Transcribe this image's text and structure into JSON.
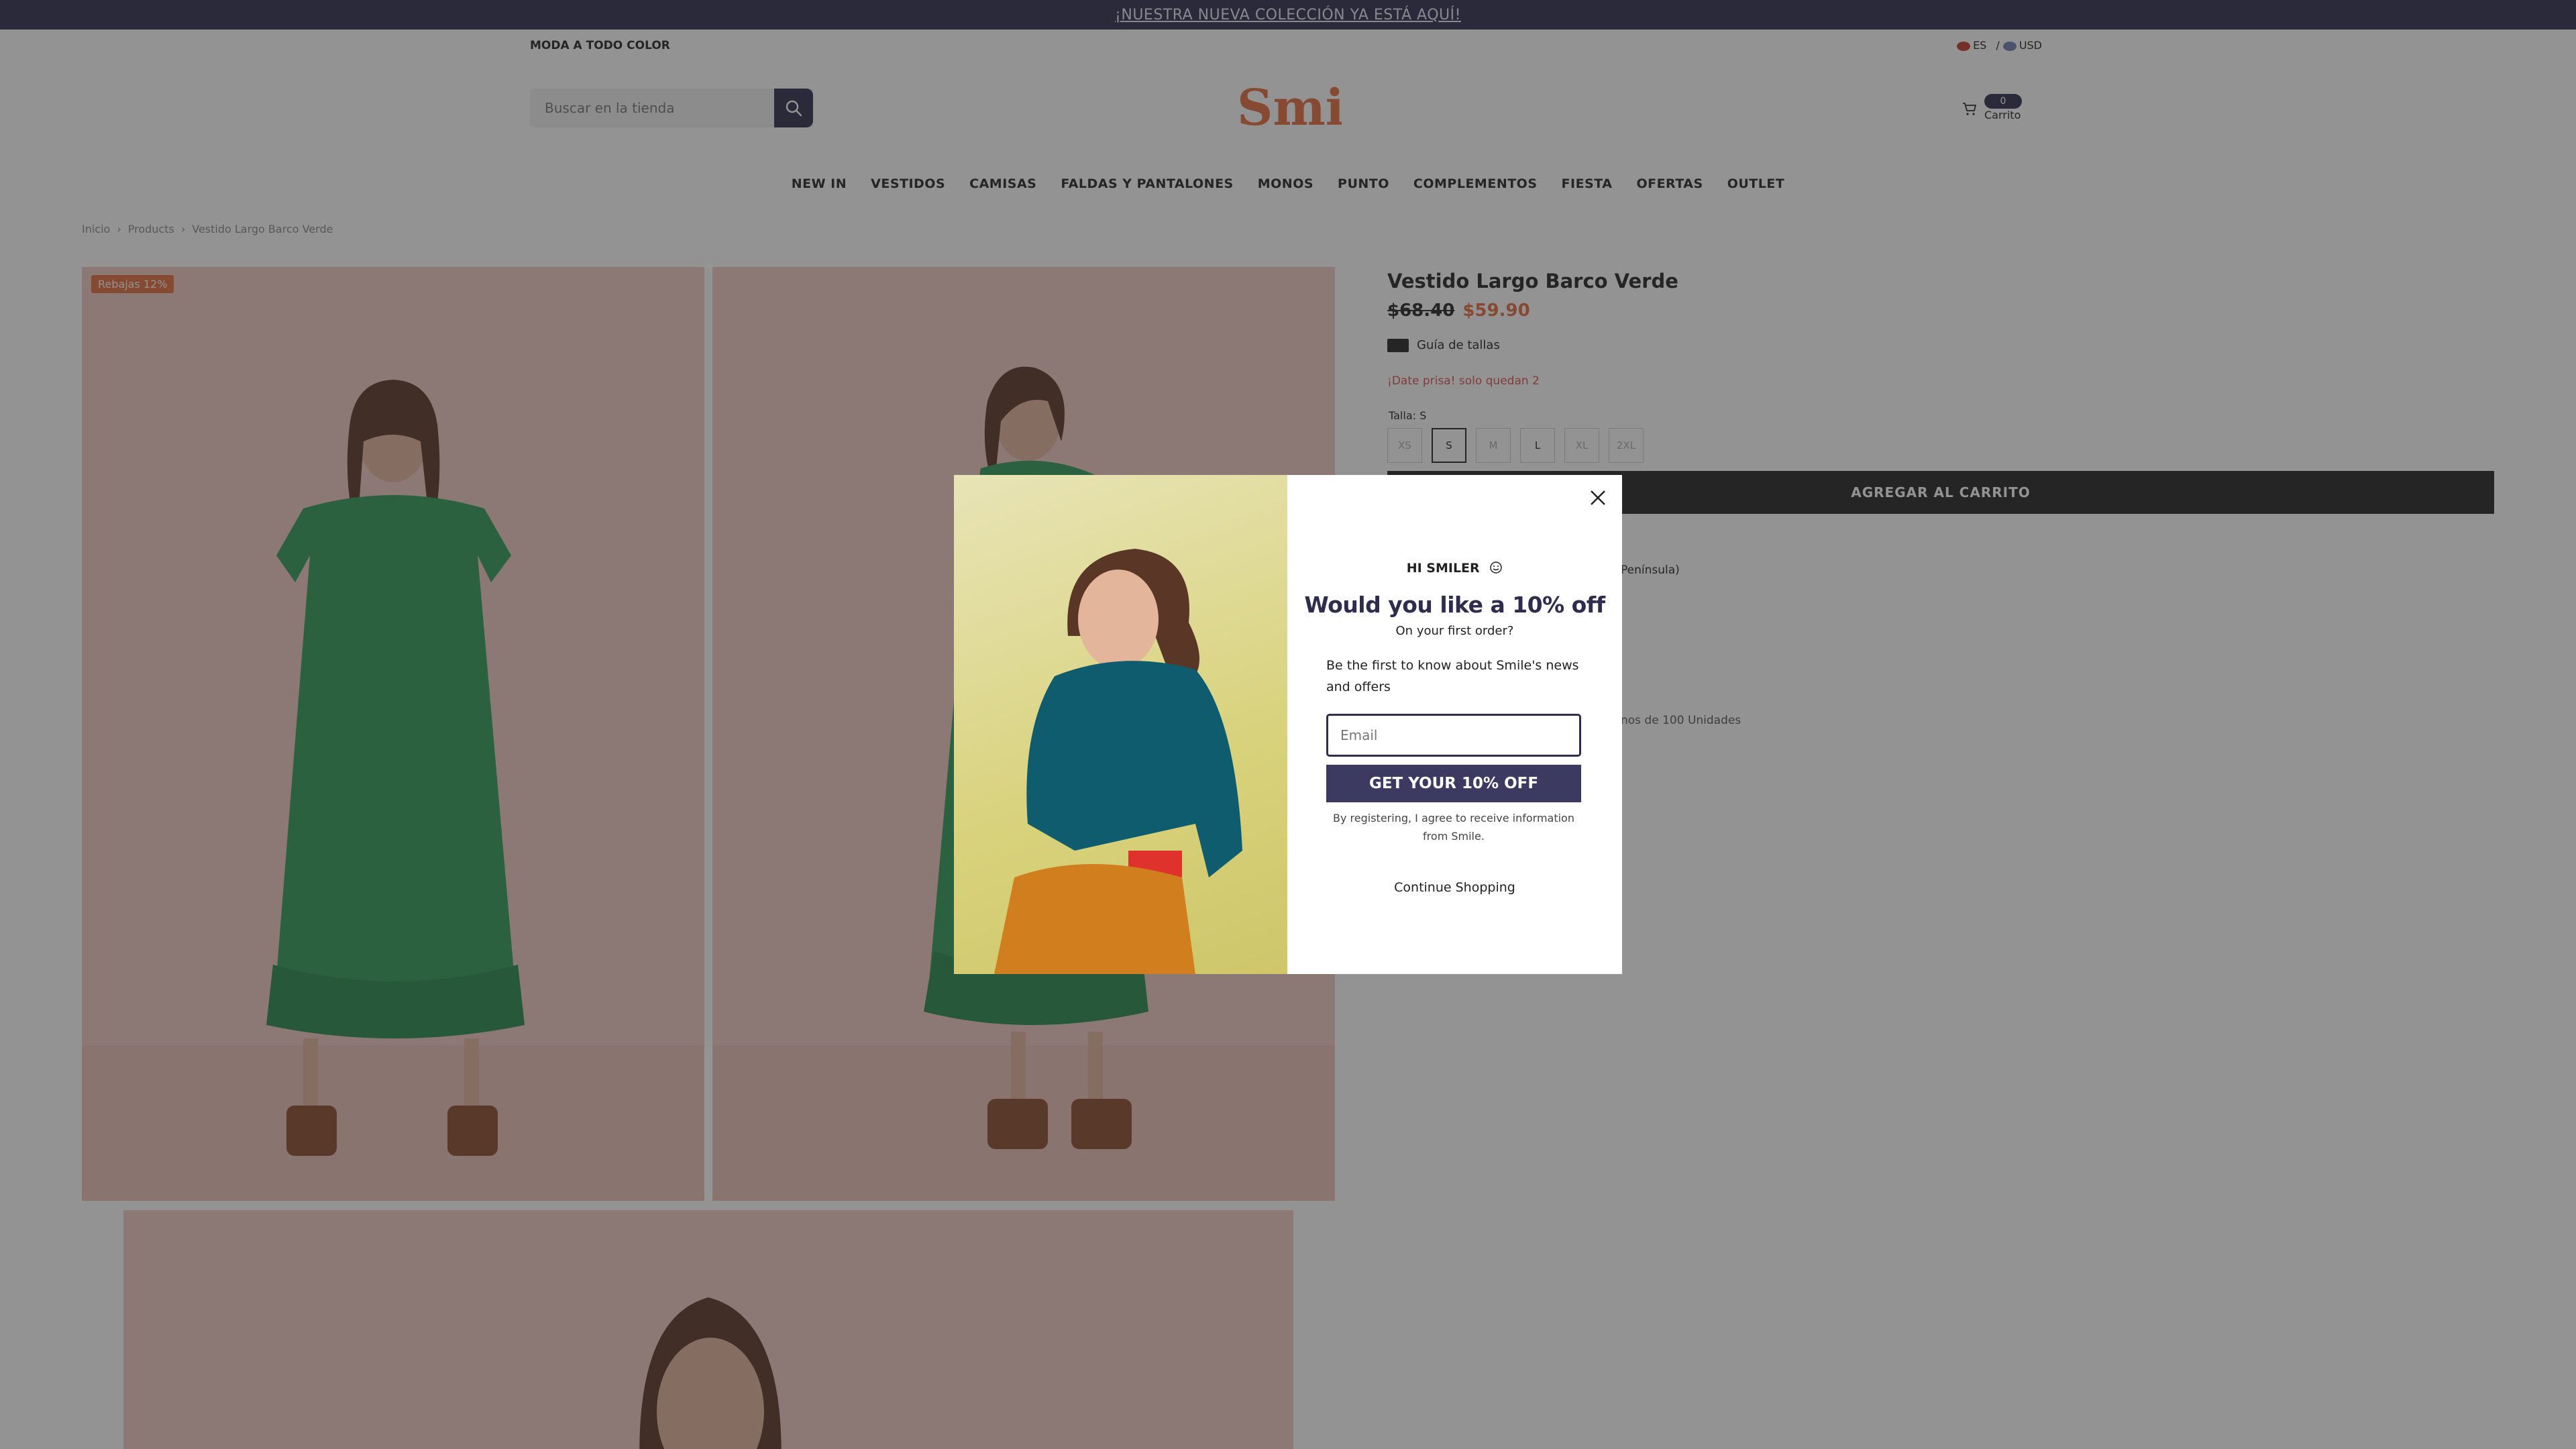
{
  "announcement": {
    "text": "¡NUESTRA NUEVA COLECCIÓN YA ESTÁ AQUÍ!"
  },
  "header": {
    "tagline": "MODA A TODO COLOR",
    "locale": {
      "language": "ES",
      "separator": "/",
      "currency": "USD"
    },
    "search": {
      "placeholder": "Buscar en la tienda"
    },
    "logo": "Smile",
    "cart": {
      "count": "0",
      "label": "Carrito"
    }
  },
  "nav": {
    "items": [
      "NEW IN",
      "VESTIDOS",
      "CAMISAS",
      "FALDAS Y PANTALONES",
      "MONOS",
      "PUNTO",
      "COMPLEMENTOS",
      "FIESTA",
      "OFERTAS",
      "OUTLET"
    ]
  },
  "breadcrumb": {
    "items": [
      "Inicio",
      "Products",
      "Vestido Largo Barco Verde"
    ],
    "separator": "›"
  },
  "product": {
    "badge": "Rebajas 12%",
    "title": "Vestido Largo Barco Verde",
    "old_price": "$68.40",
    "new_price": "$59.90",
    "size_guide": "Guía de tallas",
    "stock_note": "¡Date prisa! solo quedan 2",
    "size_label": "Talla:",
    "selected_size": "S",
    "sizes": [
      "XS",
      "S",
      "M",
      "L",
      "XL",
      "2XL"
    ],
    "add_to_cart": "AGREGAR AL CARRITO",
    "shipping_fragment": "Península)",
    "units_fragment": "nos de 100 Unidades"
  },
  "popup": {
    "greeting": "HI SMILER",
    "headline": "Would you like a 10% off",
    "subheadline": "On your first order?",
    "body": "Be the first to know about Smile's news and offers",
    "email_placeholder": "Email",
    "cta": "GET YOUR 10% OFF",
    "legal": "By registering, I agree to receive information from Smile.",
    "continue": "Continue Shopping"
  },
  "colors": {
    "brand_navy": "#2f2d4e",
    "accent_orange": "#e46b3d",
    "stock_red": "#d9534f",
    "image_pink": "#f1c9c2",
    "dress_green": "#2e9a55"
  }
}
